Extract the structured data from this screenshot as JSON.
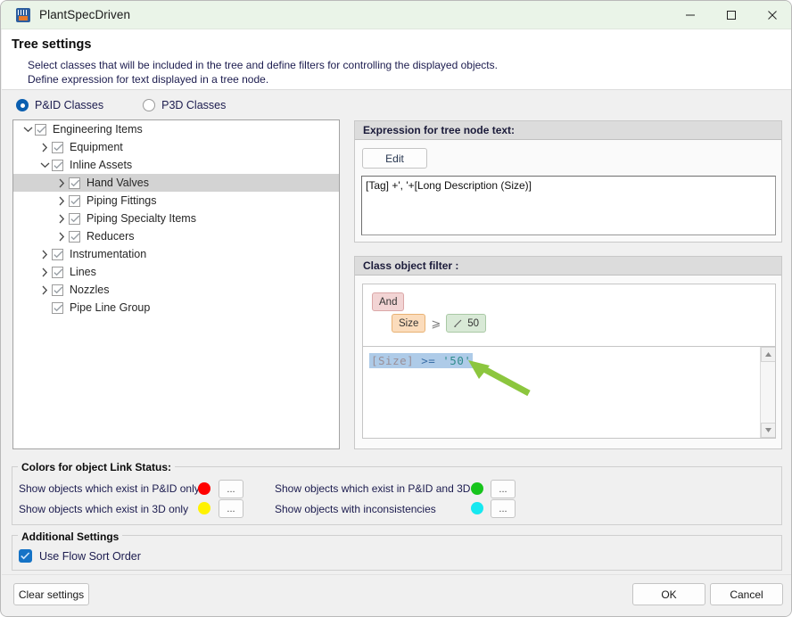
{
  "window": {
    "title": "PlantSpecDriven",
    "app_icon": "plant-app-icon",
    "minimize": "—",
    "maximize": "□",
    "close": "✕"
  },
  "header": {
    "title": "Tree settings",
    "description_line1": "Select classes that will be included in the tree and define filters for controlling the displayed objects.",
    "description_line2": "Define expression for text displayed in a tree node."
  },
  "class_mode": {
    "options": [
      {
        "label": "P&ID Classes",
        "selected": true
      },
      {
        "label": "P3D Classes",
        "selected": false
      }
    ]
  },
  "tree": {
    "nodes": [
      {
        "label": "Engineering Items",
        "indent": 0,
        "expander": "down",
        "checked": true,
        "selected": false
      },
      {
        "label": "Equipment",
        "indent": 1,
        "expander": "right",
        "checked": true,
        "selected": false
      },
      {
        "label": "Inline Assets",
        "indent": 1,
        "expander": "down",
        "checked": true,
        "selected": false
      },
      {
        "label": "Hand Valves",
        "indent": 2,
        "expander": "right",
        "checked": true,
        "selected": true
      },
      {
        "label": "Piping Fittings",
        "indent": 2,
        "expander": "right",
        "checked": true,
        "selected": false
      },
      {
        "label": "Piping Specialty Items",
        "indent": 2,
        "expander": "right",
        "checked": true,
        "selected": false
      },
      {
        "label": "Reducers",
        "indent": 2,
        "expander": "right",
        "checked": true,
        "selected": false
      },
      {
        "label": "Instrumentation",
        "indent": 1,
        "expander": "right",
        "checked": true,
        "selected": false
      },
      {
        "label": "Lines",
        "indent": 1,
        "expander": "right",
        "checked": true,
        "selected": false
      },
      {
        "label": "Nozzles",
        "indent": 1,
        "expander": "right",
        "checked": true,
        "selected": false
      },
      {
        "label": "Pipe Line Group",
        "indent": 1,
        "expander": "none",
        "checked": true,
        "selected": false
      }
    ]
  },
  "expression": {
    "group_title": "Expression for tree node text:",
    "edit_button": "Edit",
    "value": "[Tag] +', '+[Long Description (Size)]"
  },
  "filter": {
    "group_title": "Class object filter :",
    "chip_and": "And",
    "chip_field": "Size",
    "chip_operator": "⩾",
    "chip_value": "50",
    "sql_field": "[Size]",
    "sql_operator": ">=",
    "sql_value": "'50'",
    "scroll_up": "▲",
    "scroll_down": "▼",
    "annotation_arrow_color": "#8CC63E"
  },
  "colors_section": {
    "legend": "Colors for object Link Status:",
    "rows": [
      {
        "label": "Show objects which exist in P&ID only",
        "color": "#FF0000",
        "button": "..."
      },
      {
        "label": "Show objects which exist in P&ID and 3D",
        "color": "#17C41C",
        "button": "..."
      },
      {
        "label": "Show objects which exist in 3D only",
        "color": "#FFF200",
        "button": "..."
      },
      {
        "label": "Show objects with inconsistencies",
        "color": "#16E8F0",
        "button": "..."
      }
    ]
  },
  "additional_settings": {
    "legend": "Additional Settings",
    "checkbox_label": "Use Flow Sort Order",
    "checkbox_checked": true,
    "accent": "#1573C6"
  },
  "footer": {
    "clear": "Clear settings",
    "ok": "OK",
    "cancel": "Cancel"
  }
}
